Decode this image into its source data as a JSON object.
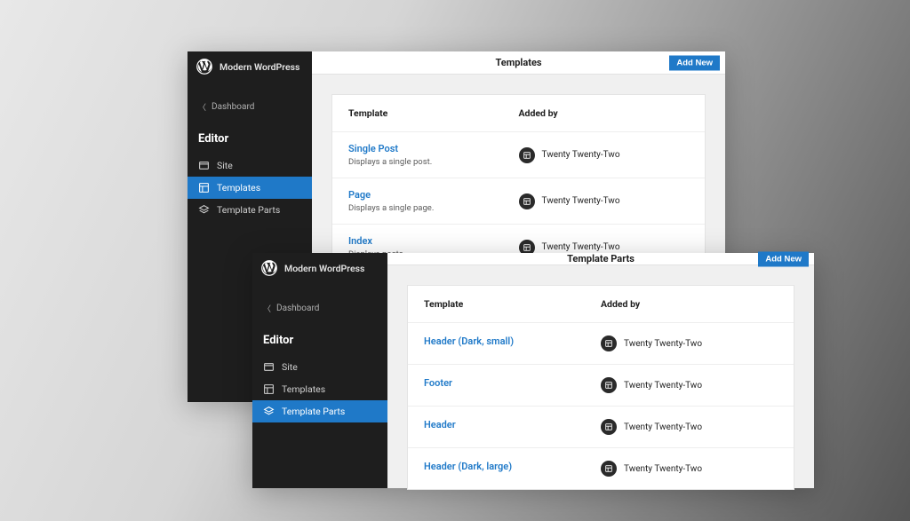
{
  "site_name": "Modern WordPress",
  "back_label": "Dashboard",
  "editor_title": "Editor",
  "nav": {
    "site": "Site",
    "templates": "Templates",
    "template_parts": "Template Parts"
  },
  "add_new_label": "Add New",
  "windows": {
    "templates": {
      "title": "Templates",
      "col_template": "Template",
      "col_added": "Added by",
      "theme": "Twenty Twenty-Two",
      "rows": [
        {
          "name": "Single Post",
          "desc": "Displays a single post."
        },
        {
          "name": "Page",
          "desc": "Displays a single page."
        },
        {
          "name": "Index",
          "desc": "Displays posts."
        }
      ]
    },
    "template_parts": {
      "title": "Template Parts",
      "col_template": "Template",
      "col_added": "Added by",
      "theme": "Twenty Twenty-Two",
      "rows": [
        {
          "name": "Header (Dark, small)"
        },
        {
          "name": "Footer"
        },
        {
          "name": "Header"
        },
        {
          "name": "Header (Dark, large)"
        }
      ]
    }
  }
}
